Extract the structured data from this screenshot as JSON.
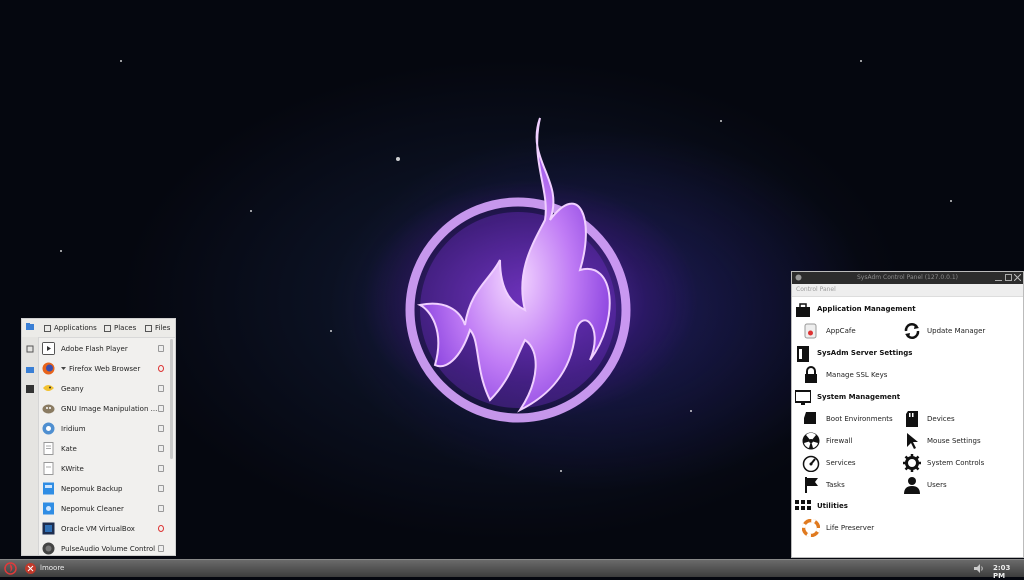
{
  "wallpaper": {
    "accent": "#a855f7",
    "background": "#05070f"
  },
  "app_menu": {
    "tabs": [
      {
        "label": "Applications",
        "icon": "applications-icon"
      },
      {
        "label": "Places",
        "icon": "places-icon"
      },
      {
        "label": "Files",
        "icon": "files-icon"
      }
    ],
    "items": [
      {
        "label": "Adobe Flash Player",
        "icon": "flash-player-icon"
      },
      {
        "label": "Firefox Web Browser",
        "icon": "firefox-icon"
      },
      {
        "label": "Geany",
        "icon": "geany-icon"
      },
      {
        "label": "GNU Image Manipulation ...",
        "icon": "gimp-icon"
      },
      {
        "label": "Iridium",
        "icon": "iridium-icon"
      },
      {
        "label": "Kate",
        "icon": "kate-icon"
      },
      {
        "label": "KWrite",
        "icon": "kwrite-icon"
      },
      {
        "label": "Nepomuk Backup",
        "icon": "nepomuk-backup-icon"
      },
      {
        "label": "Nepomuk Cleaner",
        "icon": "nepomuk-cleaner-icon"
      },
      {
        "label": "Oracle VM VirtualBox",
        "icon": "virtualbox-icon"
      },
      {
        "label": "PulseAudio Volume Control",
        "icon": "pulseaudio-icon"
      }
    ]
  },
  "control_panel": {
    "title": "SysAdm Control Panel (127.0.0.1)",
    "menu_label": "Control Panel",
    "categories": [
      {
        "label": "Application Management",
        "icon": "briefcase-icon",
        "items": [
          {
            "label": "AppCafe",
            "icon": "appcafe-icon"
          },
          {
            "label": "Update Manager",
            "icon": "refresh-icon"
          }
        ]
      },
      {
        "label": "SysAdm Server Settings",
        "icon": "server-icon",
        "items": [
          {
            "label": "Manage SSL Keys",
            "icon": "lock-icon"
          }
        ]
      },
      {
        "label": "System Management",
        "icon": "monitor-icon",
        "items": [
          {
            "label": "Boot Environments",
            "icon": "boot-icon"
          },
          {
            "label": "Devices",
            "icon": "sd-card-icon"
          },
          {
            "label": "Firewall",
            "icon": "radiation-icon"
          },
          {
            "label": "Mouse Settings",
            "icon": "cursor-icon"
          },
          {
            "label": "Services",
            "icon": "gauge-icon"
          },
          {
            "label": "System Controls",
            "icon": "gear-icon"
          },
          {
            "label": "Tasks",
            "icon": "flag-icon"
          },
          {
            "label": "Users",
            "icon": "user-icon"
          }
        ]
      },
      {
        "label": "Utilities",
        "icon": "grid-icon",
        "items": [
          {
            "label": "Life Preserver",
            "icon": "life-preserver-icon"
          }
        ]
      }
    ]
  },
  "taskbar": {
    "task_label": "lmoore",
    "clock": "2:03 PM"
  }
}
